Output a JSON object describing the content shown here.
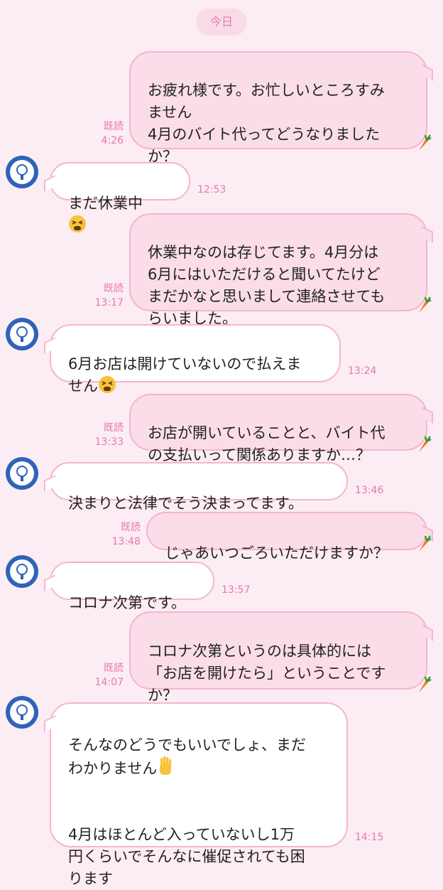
{
  "date_label": "今日",
  "read_label": "既読",
  "messages": [
    {
      "text": "お疲れ様です。お忙しいところすみ\nません\n4月のバイト代ってどうなりました\nか？",
      "time": "4:26"
    },
    {
      "text": "まだ休業中",
      "emoji": "tired-face",
      "time": "12:53"
    },
    {
      "text": "休業中なのは存じてます。4月分は\n6月にはいただけると聞いてたけど\nまだかなと思いまして連絡させても\nらいました。",
      "time": "13:17"
    },
    {
      "text": "6月お店は開けていないので払えま\nせん",
      "emoji": "tired-face",
      "time": "13:24"
    },
    {
      "text": "お店が開いていることと、バイト代\nの支払いって関係ありますか…？",
      "time": "13:33"
    },
    {
      "text": "決まりと法律でそう決まってます。",
      "time": "13:46"
    },
    {
      "text": "じゃあいつごろいただけますか？",
      "time": "13:48"
    },
    {
      "text": "コロナ次第です。",
      "time": "13:57"
    },
    {
      "text": "コロナ次第というのは具体的には\n「お店を開けたら」ということです\nか？",
      "time": "14:07"
    },
    {
      "text_a": "そんなのどうでもいいでしょ、まだ\nわかりません",
      "text_b": "4月はほとんど入っていないし1万\n円くらいでそんなに催促されても困\nります",
      "emoji": "raised-hand",
      "time": "14:15"
    }
  ],
  "colors": {
    "background": "#fcecf3",
    "sent_bubble": "#fadde9",
    "border": "#f3b6cf",
    "accent": "#e57ba6",
    "avatar": "#2e63b8"
  },
  "icons": {
    "avatar": "lightbulb-avatar-icon",
    "sent_marker": "carrot-icon"
  }
}
